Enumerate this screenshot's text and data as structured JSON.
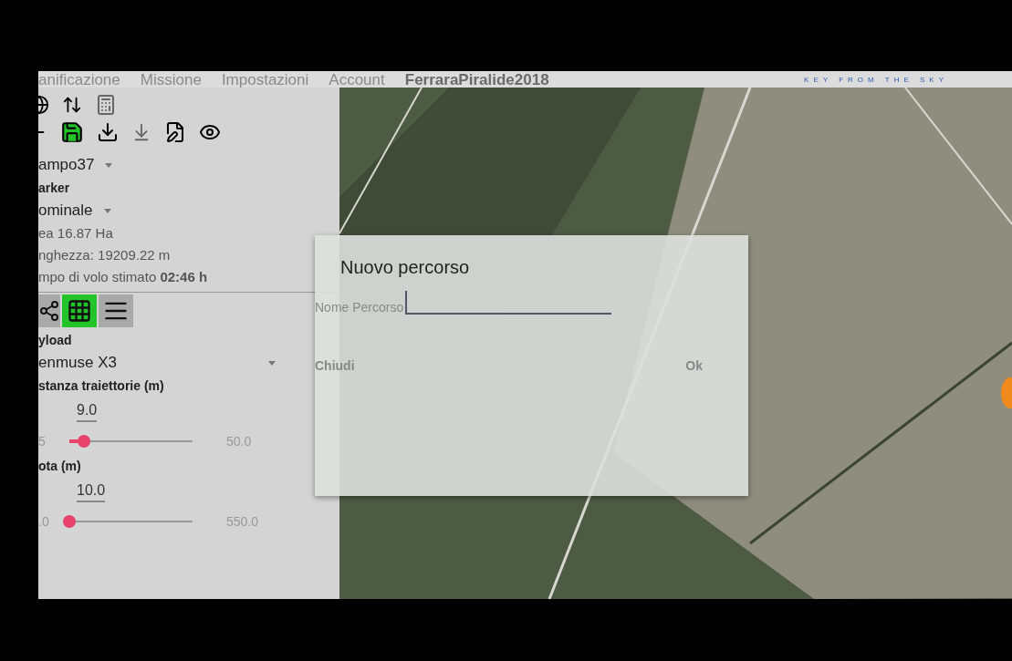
{
  "menu": {
    "items": [
      "anificazione",
      "Missione",
      "Impostazioni",
      "Account"
    ],
    "project": "FerraraPiralide2018",
    "tagline": "KEY FROM THE SKY"
  },
  "panel": {
    "field": "ampo37",
    "marker_label": "arker",
    "profile": "ominale",
    "area": "ea 16.87 Ha",
    "length": "nghezza: 19209.22 m",
    "time": "mpo di volo stimato **02:46 h**",
    "modes": [
      {
        "kind": "path",
        "selected": false
      },
      {
        "kind": "grid",
        "selected": true
      },
      {
        "kind": "lines",
        "selected": false
      }
    ],
    "payload_label": "yload",
    "payload": "enmuse X3",
    "sliders": [
      {
        "label": "stanza traiettorie (m)",
        "value": "9.0",
        "min": "5",
        "max": "50.0",
        "level": 0.12
      },
      {
        "label": "ota (m)",
        "value": "10.0",
        "min": ".0",
        "max": "550.0",
        "level": 0.0
      }
    ]
  },
  "dialog": {
    "title": "Nuovo percorso",
    "field_label": "Nome Percorso",
    "buttons": [
      "Chiudi",
      "Ok"
    ]
  }
}
